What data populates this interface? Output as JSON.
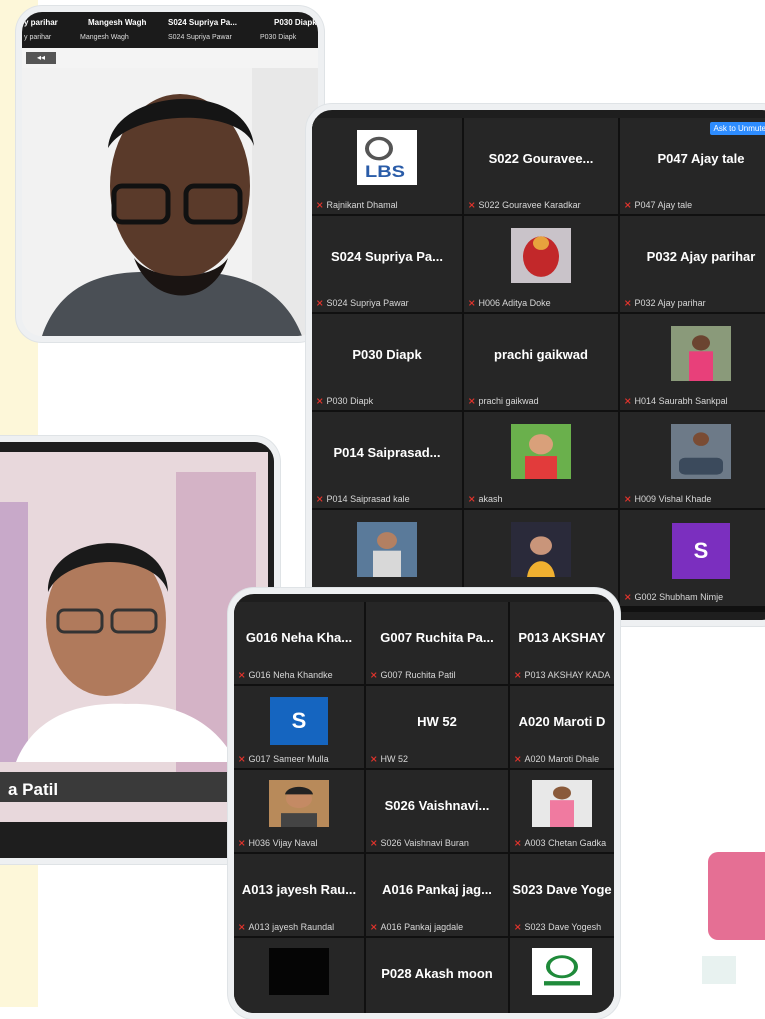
{
  "card1": {
    "strip_names": [
      "y parihar",
      "Mangesh Wagh",
      "S024 Supriya Pa...",
      "P030 Diapk"
    ],
    "strip_subs": [
      "y parihar",
      "Mangesh Wagh",
      "S024 Supriya Pawar",
      "P030 Diapk"
    ],
    "control": "◂◂"
  },
  "card2": {
    "tiles": [
      {
        "big": "",
        "sub": "Rajnikant Dhamal",
        "photo": "lbs-logo"
      },
      {
        "big": "S022 Gouravee...",
        "sub": "S022 Gouravee Karadkar"
      },
      {
        "big": "P047 Ajay tale",
        "sub": "P047 Ajay tale",
        "button": "Ask to Unmute",
        "button2": "..."
      },
      {
        "big": "S024 Supriya Pa...",
        "sub": "S024 Supriya Pawar"
      },
      {
        "big": "",
        "sub": "H006 Aditya Doke",
        "photo": "deity-photo"
      },
      {
        "big": "P032 Ajay parihar",
        "sub": "P032 Ajay parihar"
      },
      {
        "big": "P030 Diapk",
        "sub": "P030 Diapk"
      },
      {
        "big": "prachi gaikwad",
        "sub": "prachi gaikwad"
      },
      {
        "big": "",
        "sub": "H014 Saurabh Sankpal",
        "photo": "person-pink"
      },
      {
        "big": "P014 Saiprasad...",
        "sub": "P014 Saiprasad kale"
      },
      {
        "big": "",
        "sub": "akash",
        "photo": "child-red"
      },
      {
        "big": "",
        "sub": "H009 Vishal Khade",
        "photo": "person-car"
      },
      {
        "big": "",
        "sub": "",
        "photo": "person-blue"
      },
      {
        "big": "",
        "sub": "",
        "photo": "girl-dark"
      },
      {
        "big": "",
        "sub": "G002 Shubham Nimje",
        "avatar": "S"
      }
    ]
  },
  "card3": {
    "name_banner": "a Patil"
  },
  "card4": {
    "tiles": [
      {
        "big": "G016 Neha Kha...",
        "sub": "G016 Neha Khandke"
      },
      {
        "big": "G007 Ruchita Pa...",
        "sub": "G007 Ruchita Patil"
      },
      {
        "big": "P013 AKSHAY",
        "sub": "P013 AKSHAY KADA"
      },
      {
        "big": "",
        "sub": "G017 Sameer Mulla",
        "avatar": "S"
      },
      {
        "big": "HW 52",
        "sub": "HW 52"
      },
      {
        "big": "A020 Maroti D",
        "sub": "A020 Maroti Dhale"
      },
      {
        "big": "",
        "sub": "H036 Vijay Naval",
        "photo": "young-man"
      },
      {
        "big": "S026 Vaishnavi...",
        "sub": "S026 Vaishnavi Buran"
      },
      {
        "big": "",
        "sub": "A003 Chetan Gadka",
        "photo": "person-shop"
      },
      {
        "big": "A013 jayesh Rau...",
        "sub": "A013 jayesh Raundal"
      },
      {
        "big": "A016 Pankaj jag...",
        "sub": "A016 Pankaj jagdale"
      },
      {
        "big": "S023 Dave Yoge",
        "sub": "S023 Dave Yogesh"
      },
      {
        "big": "",
        "sub": "",
        "photo": "black"
      },
      {
        "big": "P028 Akash moon",
        "sub": ""
      },
      {
        "big": "",
        "sub": "",
        "photo": "green-logo"
      }
    ]
  },
  "colors": {
    "accent": "#2d8cff",
    "mic_muted": "#e0332c",
    "avatar_purple": "#7b2fbf",
    "avatar_blue": "#1565c0",
    "pink_block": "#e56f94"
  }
}
